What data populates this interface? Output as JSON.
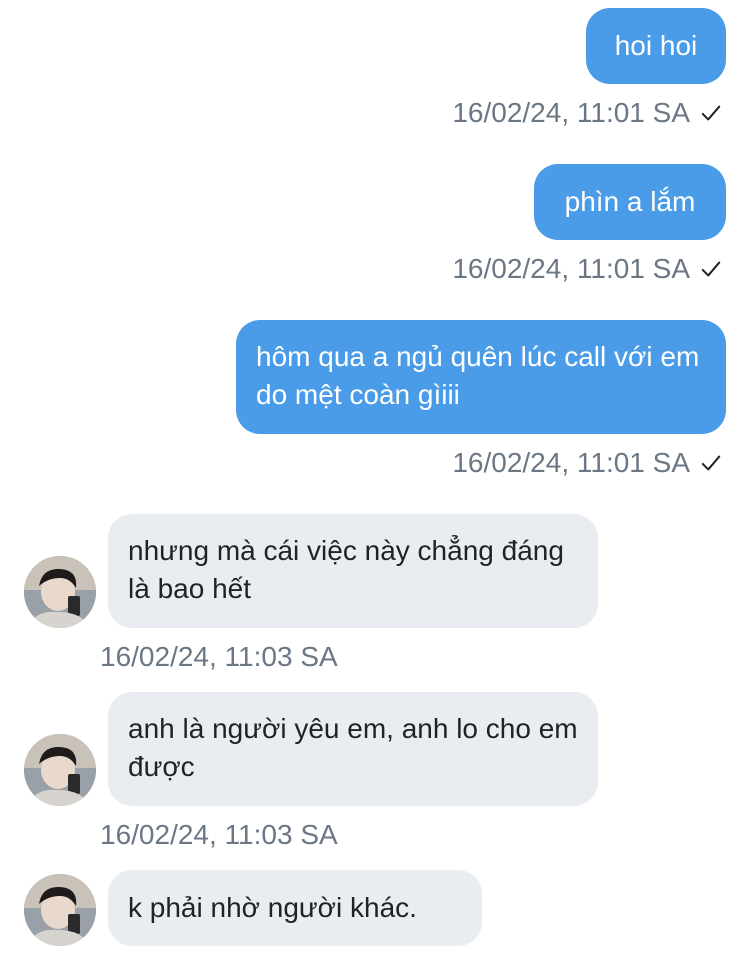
{
  "messages": [
    {
      "from": "me",
      "text": "hoi hoi",
      "time": "16/02/24, 11:01 SA",
      "status": "sent-check-icon"
    },
    {
      "from": "me",
      "text": "phìn a lắm",
      "time": "16/02/24, 11:01 SA",
      "status": "sent-check-icon"
    },
    {
      "from": "me",
      "text": "hôm qua a ngủ quên lúc call với em do mệt coàn gìiii",
      "time": "16/02/24, 11:01 SA",
      "status": "sent-check-icon"
    },
    {
      "from": "them",
      "text": "nhưng mà cái việc này chẳng đáng là bao hết",
      "time": "16/02/24, 11:03 SA"
    },
    {
      "from": "them",
      "text": "anh là người yêu em, anh lo cho em được",
      "time": "16/02/24, 11:03 SA"
    },
    {
      "from": "them",
      "text": "k phải nhờ người khác.",
      "time": ""
    }
  ],
  "colors": {
    "sent_bubble": "#4a9be8",
    "received_bubble": "#e9ecf0",
    "timestamp": "#6b7785"
  }
}
